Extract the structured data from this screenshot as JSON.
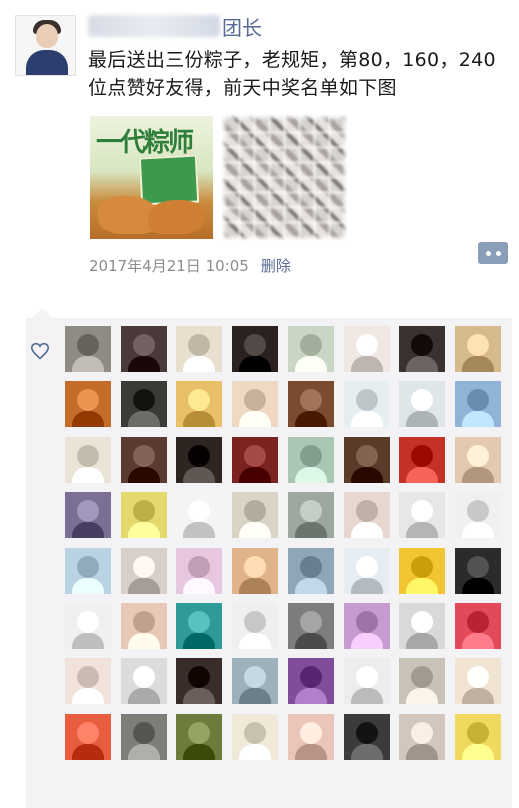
{
  "post": {
    "nickname": "团长",
    "text": "最后送出三份粽子，老规矩，第80，160，240位点赞好友得，前天中奖名单如下图",
    "photos": [
      {
        "icon": "zongzi-product-photo",
        "brush_text": "一代粽师"
      },
      {
        "icon": "blurred-winner-list-photo"
      }
    ],
    "time": "2017年4月21日 10:05",
    "delete_label": "删除",
    "comment_icon": "more-dots-icon"
  },
  "likes": {
    "icon": "heart-icon",
    "colors": {
      "panel": "#f3f3f5",
      "link": "#576b95"
    },
    "avatars": [
      [
        "#8f8a83",
        "#4a3b3a",
        "#e9dfcf",
        "#2b2220",
        "#c9d6c3",
        "#f1e7e2",
        "#3b3230",
        "#d7b98e"
      ],
      [
        "#c46d2b",
        "#3c3a36",
        "#e8c06a",
        "#f0d9c3",
        "#7a4b2f",
        "#e6eef2",
        "#dfe6ea",
        "#8fb4d8"
      ],
      [
        "#e9e2d5",
        "#5b3a32",
        "#2e2521",
        "#7a2320",
        "#a9c7b3",
        "#5a3b2a",
        "#c53127",
        "#e2c9b0"
      ],
      [
        "#7b6f94",
        "#e3d96c",
        "#f4f4f4",
        "#d9d4c6",
        "#9ca7a0",
        "#e8d7cf",
        "#e7e7e7",
        "#f0f0f0"
      ],
      [
        "#b9d3e2",
        "#d8cfc8",
        "#e7c6df",
        "#e0b48b",
        "#8fa6b9",
        "#e5edf3",
        "#f2c533",
        "#2b2b2b"
      ],
      [
        "#f0f0f0",
        "#e9c8b8",
        "#2f9a9a",
        "#efefef",
        "#7d7d7d",
        "#c89bd0",
        "#d9d9d9",
        "#e24a5a"
      ],
      [
        "#f1e3dc",
        "#dcdcdc",
        "#3a2d29",
        "#9fb0bd",
        "#7f4d9a",
        "#ededed",
        "#c9c2b8",
        "#f2e4d3"
      ],
      [
        "#e85c40",
        "#7e7e78",
        "#6b7c3b",
        "#f1e9d8",
        "#e9c6b8",
        "#3b3b3b",
        "#d3c6bc",
        "#f1d85e"
      ],
      [
        "#d9a47f",
        "#c9a06a",
        "#c7b3a6",
        "#e1d6cd",
        "#f2c5d6",
        "#4fa53c",
        "#e3b089",
        "#e8ddd3"
      ]
    ]
  }
}
